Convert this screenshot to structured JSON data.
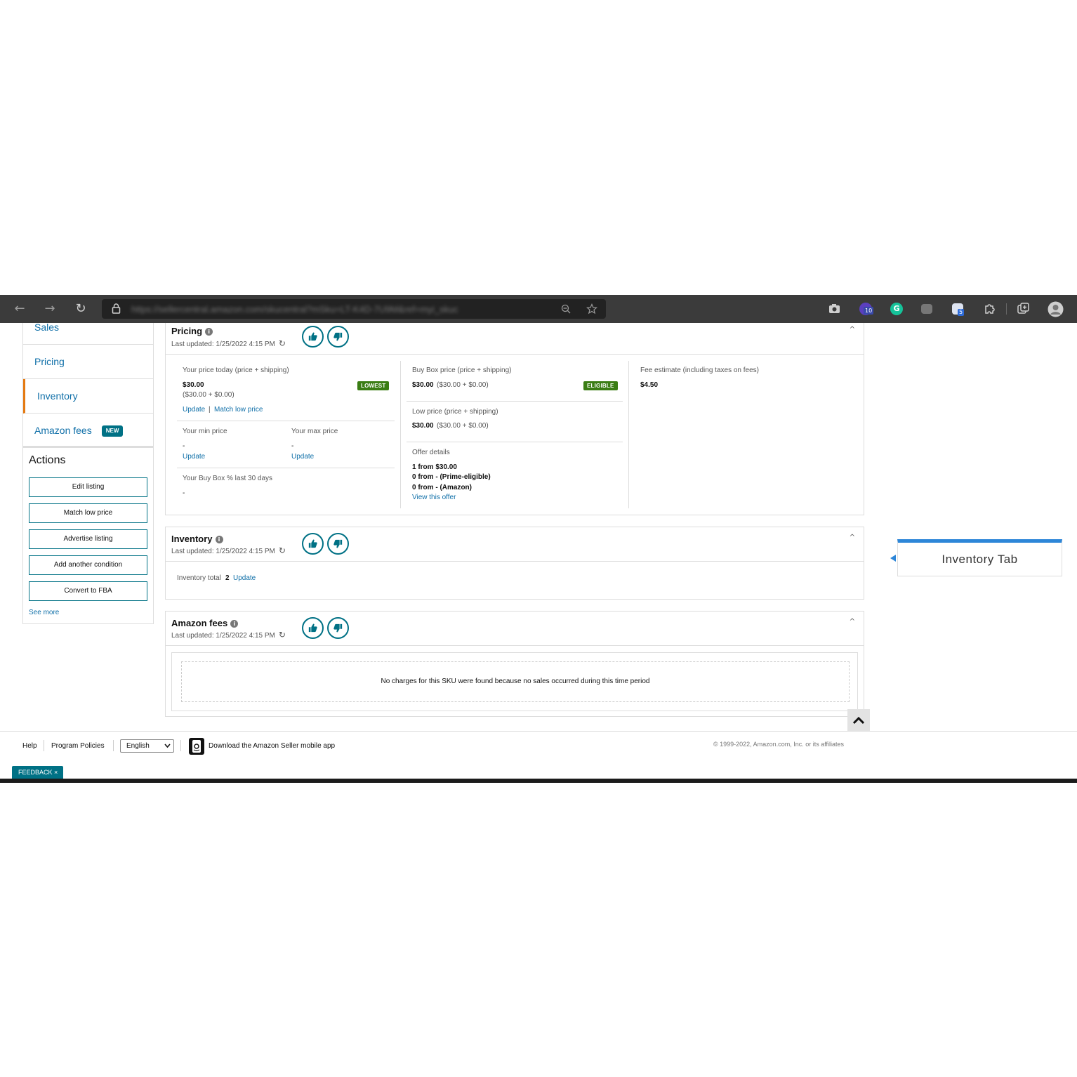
{
  "browser": {
    "url": "https://sellercentral.amazon.com/skucentral?mSku=LT-K4D-7U9M&ref=myi_skuc"
  },
  "sidebar": {
    "items": [
      {
        "label": "Sales"
      },
      {
        "label": "Pricing"
      },
      {
        "label": "Inventory"
      },
      {
        "label": "Amazon fees",
        "badge": "NEW"
      }
    ],
    "actions_title": "Actions",
    "actions": [
      "Edit listing",
      "Match low price",
      "Advertise listing",
      "Add another condition",
      "Convert to FBA"
    ],
    "see_more": "See more"
  },
  "pricing": {
    "title": "Pricing",
    "last_updated": "Last updated:  1/25/2022 4:15 PM",
    "your_price_label": "Your price today (price + shipping)",
    "your_price": "$30.00",
    "your_price_breakdown": "($30.00 + $0.00)",
    "lowest_badge": "LOWEST",
    "update": "Update",
    "sep": "|",
    "match_low_price": "Match low price",
    "min_price_label": "Your min price",
    "min_price": "-",
    "min_update": "Update",
    "max_price_label": "Your max price",
    "max_price": "-",
    "max_update": "Update",
    "buybox_pct_label": "Your Buy Box % last 30 days",
    "buybox_pct": "-",
    "buybox_price_label": "Buy Box price (price + shipping)",
    "buybox_price": "$30.00",
    "buybox_breakdown": "($30.00 + $0.00)",
    "eligible_badge": "ELIGIBLE",
    "low_price_label": "Low price (price + shipping)",
    "low_price": "$30.00",
    "low_breakdown": "($30.00 + $0.00)",
    "offer_details_label": "Offer details",
    "offers": [
      "1 from $30.00",
      "0 from - (Prime-eligible)",
      "0 from - (Amazon)"
    ],
    "view_offer": "View this offer",
    "fee_label": "Fee estimate (including taxes on fees)",
    "fee_value": "$4.50"
  },
  "inventory": {
    "title": "Inventory",
    "last_updated": "Last updated:  1/25/2022 4:15 PM",
    "total_label": "Inventory total",
    "total_value": "2",
    "update": "Update"
  },
  "fees": {
    "title": "Amazon fees",
    "last_updated": "Last updated:  1/25/2022 4:15 PM",
    "empty_message": "No charges for this SKU were found because no sales occurred during this time period"
  },
  "footer": {
    "help": "Help",
    "program_policies": "Program Policies",
    "language": "English",
    "app_download": "Download the Amazon Seller mobile app",
    "copyright": "© 1999-2022, Amazon.com, Inc. or its affiliates",
    "feedback": "FEEDBACK ×"
  },
  "annotation": {
    "label": "Inventory Tab"
  },
  "colors": {
    "link": "#0f6fa8",
    "teal": "#007185",
    "active_nav": "#e47911",
    "badge_green": "#3a7d14",
    "annotation": "#2d86d8"
  }
}
